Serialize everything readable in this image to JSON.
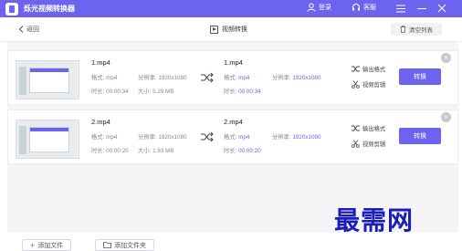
{
  "app": {
    "title": "烁光视频转换器",
    "brand_color": "#6c63ee",
    "login_label": "登录",
    "service_label": "客服"
  },
  "toolbar": {
    "back_label": "返回",
    "page_title": "视频转换",
    "clear_label": "清空列表"
  },
  "files": [
    {
      "source": {
        "name": "1.mp4",
        "format_label": "格式:",
        "format": "mp4",
        "res_label": "分辨率:",
        "resolution": "1920x1080",
        "duration_label": "时长:",
        "duration": "00:00:34",
        "size_label": "大小:",
        "size": "5.29 MB"
      },
      "target": {
        "name": "1.mp4",
        "format_label": "格式:",
        "format": "mp4",
        "res_label": "分辨率:",
        "resolution": "1920x1080",
        "duration_label": "时长:",
        "duration": "00:00:34"
      },
      "output_format_label": "输出格式",
      "video_edit_label": "视频剪辑",
      "convert_label": "转换"
    },
    {
      "source": {
        "name": "2.mp4",
        "format_label": "格式:",
        "format": "mp4",
        "res_label": "分辨率:",
        "resolution": "1920x1080",
        "duration_label": "时长:",
        "duration": "00:00:20",
        "size_label": "大小:",
        "size": "1.93 MB"
      },
      "target": {
        "name": "2.mp4",
        "format_label": "格式:",
        "format": "mp4",
        "res_label": "分辨率:",
        "resolution": "1920x1080",
        "duration_label": "时长:",
        "duration": "00:00:20"
      },
      "output_format_label": "输出格式",
      "video_edit_label": "视频剪辑",
      "convert_label": "转换"
    }
  ],
  "bottom": {
    "add_file_label": "添加文件",
    "add_folder_label": "添加文件夹"
  },
  "watermark": "最需网"
}
